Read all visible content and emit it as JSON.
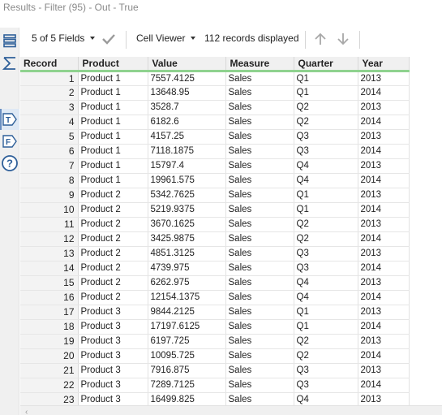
{
  "window": {
    "title": "Results - Filter (95) - Out - True"
  },
  "toolbar": {
    "fields_label": "5 of 5 Fields",
    "viewer_label": "Cell Viewer",
    "records_label": "112 records displayed"
  },
  "sidebar": {
    "icons": [
      "fields-list-icon",
      "summation-icon",
      "text-badge-icon",
      "formula-badge-icon",
      "help-icon"
    ]
  },
  "table": {
    "columns": [
      "Record",
      "Product",
      "Value",
      "Measure",
      "Quarter",
      "Year"
    ],
    "rows": [
      [
        "1",
        "Product 1",
        "7557.4125",
        "Sales",
        "Q1",
        "2013"
      ],
      [
        "2",
        "Product 1",
        "13648.95",
        "Sales",
        "Q1",
        "2014"
      ],
      [
        "3",
        "Product 1",
        "3528.7",
        "Sales",
        "Q2",
        "2013"
      ],
      [
        "4",
        "Product 1",
        "6182.6",
        "Sales",
        "Q2",
        "2014"
      ],
      [
        "5",
        "Product 1",
        "4157.25",
        "Sales",
        "Q3",
        "2013"
      ],
      [
        "6",
        "Product 1",
        "7118.1875",
        "Sales",
        "Q3",
        "2014"
      ],
      [
        "7",
        "Product 1",
        "15797.4",
        "Sales",
        "Q4",
        "2013"
      ],
      [
        "8",
        "Product 1",
        "19961.575",
        "Sales",
        "Q4",
        "2014"
      ],
      [
        "9",
        "Product 2",
        "5342.7625",
        "Sales",
        "Q1",
        "2013"
      ],
      [
        "10",
        "Product 2",
        "5219.9375",
        "Sales",
        "Q1",
        "2014"
      ],
      [
        "11",
        "Product 2",
        "3670.1625",
        "Sales",
        "Q2",
        "2013"
      ],
      [
        "12",
        "Product 2",
        "3425.9875",
        "Sales",
        "Q2",
        "2014"
      ],
      [
        "13",
        "Product 2",
        "4851.3125",
        "Sales",
        "Q3",
        "2013"
      ],
      [
        "14",
        "Product 2",
        "4739.975",
        "Sales",
        "Q3",
        "2014"
      ],
      [
        "15",
        "Product 2",
        "6262.975",
        "Sales",
        "Q4",
        "2013"
      ],
      [
        "16",
        "Product 2",
        "12154.1375",
        "Sales",
        "Q4",
        "2014"
      ],
      [
        "17",
        "Product 3",
        "9844.2125",
        "Sales",
        "Q1",
        "2013"
      ],
      [
        "18",
        "Product 3",
        "17197.6125",
        "Sales",
        "Q1",
        "2014"
      ],
      [
        "19",
        "Product 3",
        "6197.725",
        "Sales",
        "Q2",
        "2013"
      ],
      [
        "20",
        "Product 3",
        "10095.725",
        "Sales",
        "Q2",
        "2014"
      ],
      [
        "21",
        "Product 3",
        "7916.875",
        "Sales",
        "Q3",
        "2013"
      ],
      [
        "22",
        "Product 3",
        "7289.7125",
        "Sales",
        "Q3",
        "2014"
      ],
      [
        "23",
        "Product 3",
        "16499.825",
        "Sales",
        "Q4",
        "2013"
      ]
    ]
  }
}
